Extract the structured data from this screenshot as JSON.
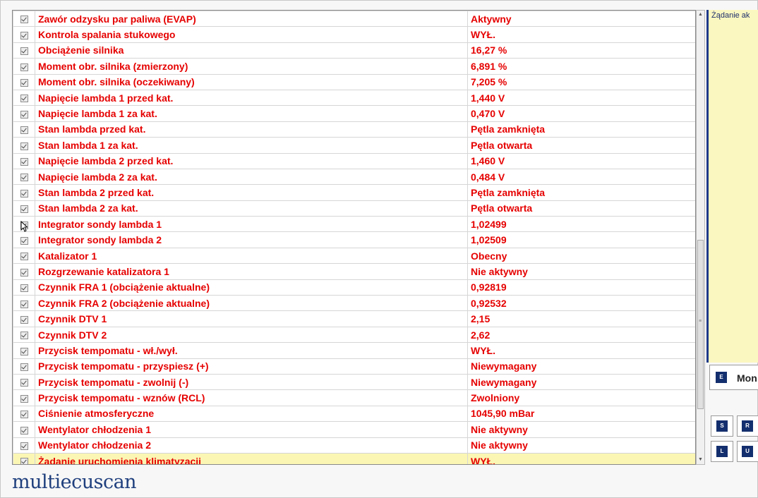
{
  "parameters": [
    {
      "name": "Zawór odzysku par paliwa (EVAP)",
      "value": "Aktywny"
    },
    {
      "name": "Kontrola spalania stukowego",
      "value": "WYŁ."
    },
    {
      "name": "Obciążenie silnika",
      "value": "16,27 %"
    },
    {
      "name": "Moment obr. silnika (zmierzony)",
      "value": "6,891 %"
    },
    {
      "name": "Moment obr. silnika (oczekiwany)",
      "value": "7,205 %"
    },
    {
      "name": "Napięcie lambda 1 przed kat.",
      "value": "1,440 V"
    },
    {
      "name": "Napięcie lambda 1 za kat.",
      "value": "0,470 V"
    },
    {
      "name": "Stan lambda przed kat.",
      "value": "Pętla zamknięta"
    },
    {
      "name": "Stan lambda 1 za kat.",
      "value": "Pętla otwarta"
    },
    {
      "name": "Napięcie lambda 2 przed kat.",
      "value": "1,460 V"
    },
    {
      "name": "Napięcie lambda 2 za kat.",
      "value": "0,484 V"
    },
    {
      "name": "Stan lambda 2 przed kat.",
      "value": "Pętla zamknięta"
    },
    {
      "name": "Stan lambda 2 za kat.",
      "value": "Pętla otwarta"
    },
    {
      "name": "Integrator sondy lambda 1",
      "value": "1,02499"
    },
    {
      "name": "Integrator sondy lambda 2",
      "value": "1,02509"
    },
    {
      "name": "Katalizator 1",
      "value": "Obecny"
    },
    {
      "name": "Rozgrzewanie katalizatora 1",
      "value": "Nie aktywny"
    },
    {
      "name": "Czynnik FRA 1 (obciążenie aktualne)",
      "value": "0,92819"
    },
    {
      "name": "Czynnik FRA 2 (obciążenie aktualne)",
      "value": "0,92532"
    },
    {
      "name": "Czynnik DTV 1",
      "value": "2,15"
    },
    {
      "name": "Czynnik DTV 2",
      "value": "2,62"
    },
    {
      "name": "Przycisk tempomatu - wł./wył.",
      "value": "WYŁ."
    },
    {
      "name": "Przycisk tempomatu - przyspiesz (+)",
      "value": "Niewymagany"
    },
    {
      "name": "Przycisk tempomatu - zwolnij (-)",
      "value": "Niewymagany"
    },
    {
      "name": "Przycisk tempomatu - wznów (RCL)",
      "value": "Zwolniony"
    },
    {
      "name": "Ciśnienie atmosferyczne",
      "value": "1045,90 mBar"
    },
    {
      "name": "Wentylator chłodzenia 1",
      "value": "Nie aktywny"
    },
    {
      "name": "Wentylator chłodzenia 2",
      "value": "Nie aktywny"
    },
    {
      "name": "Żądanie uruchomienia klimatyzacji",
      "value": "WYŁ."
    }
  ],
  "selected_row": 28,
  "right_panel": {
    "title": "Żądanie ak"
  },
  "buttons": {
    "monitor": {
      "key": "E",
      "label": "Mon"
    },
    "s": {
      "key": "S"
    },
    "r": {
      "key": "R"
    },
    "l": {
      "key": "L"
    },
    "u": {
      "key": "U"
    }
  },
  "scrollbar_grip": "≡",
  "logo": {
    "text": "multiecuscan"
  },
  "colors": {
    "text": "#e60000",
    "highlight": "#fbf6b4",
    "panel": "#fbf7c0",
    "accent": "#142f6e"
  }
}
